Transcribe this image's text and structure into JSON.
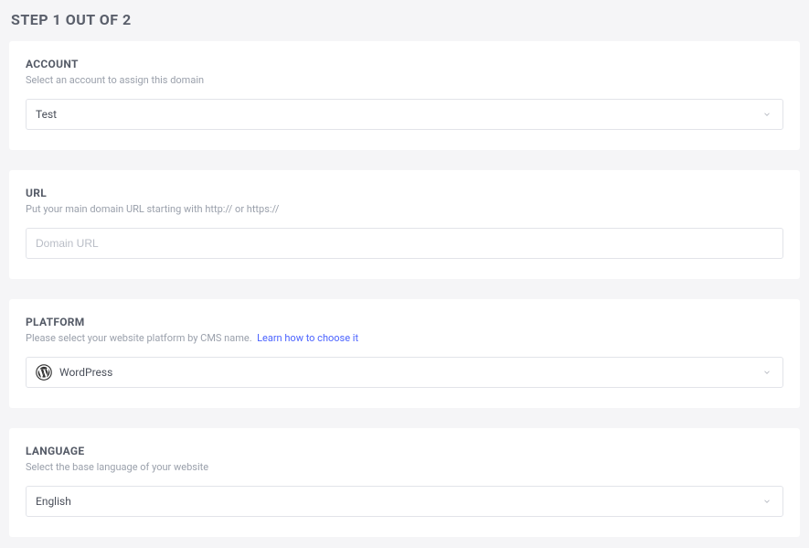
{
  "header": {
    "title": "STEP 1 OUT OF 2"
  },
  "account": {
    "label": "ACCOUNT",
    "desc": "Select an account to assign this domain",
    "value": "Test"
  },
  "url": {
    "label": "URL",
    "desc": "Put your main domain URL starting with http:// or https://",
    "placeholder": "Domain URL"
  },
  "platform": {
    "label": "PLATFORM",
    "desc": "Please select your website platform by CMS name.",
    "link_text": "Learn how to choose it",
    "value": "WordPress"
  },
  "language": {
    "label": "LANGUAGE",
    "desc": "Select the base language of your website",
    "value": "English"
  }
}
